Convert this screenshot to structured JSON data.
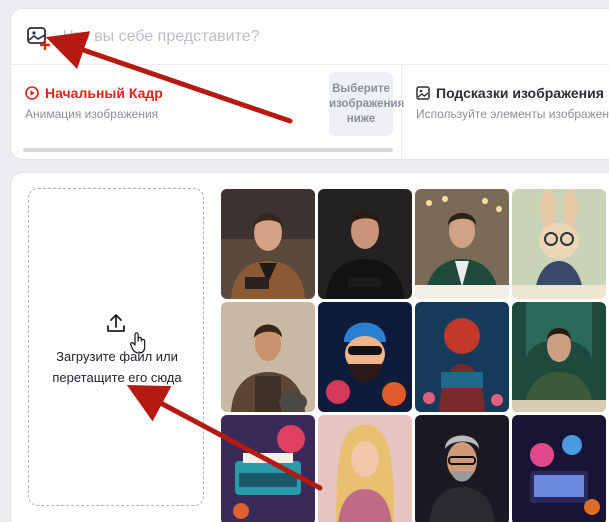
{
  "prompt": {
    "placeholder": "Что вы себе представите?"
  },
  "start_frame": {
    "title": "Начальный Кадр",
    "subtitle": "Анимация изображения",
    "select_button": "Выберите изображения ниже"
  },
  "image_hints": {
    "title": "Подсказки изображения",
    "subtitle": "Используйте элементы изображен"
  },
  "upload": {
    "line1": "Загрузите файл или",
    "line2": "перетащите его сюда"
  },
  "colors": {
    "accent_red": "#d8261c",
    "annotation_arrow": "#b51a12"
  },
  "gallery": {
    "rows": 3,
    "columns": 4
  }
}
